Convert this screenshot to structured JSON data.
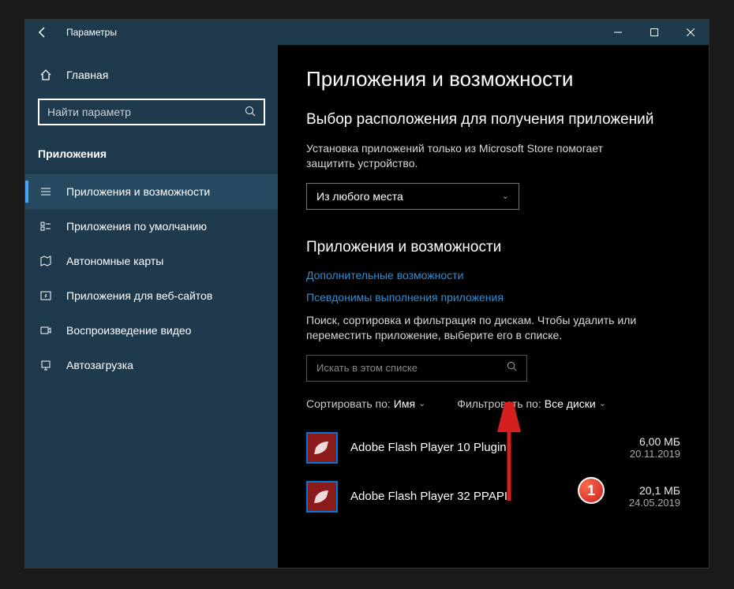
{
  "titlebar": {
    "title": "Параметры"
  },
  "sidebar": {
    "home": "Главная",
    "search_placeholder": "Найти параметр",
    "category": "Приложения",
    "items": [
      {
        "label": "Приложения и возможности"
      },
      {
        "label": "Приложения по умолчанию"
      },
      {
        "label": "Автономные карты"
      },
      {
        "label": "Приложения для веб-сайтов"
      },
      {
        "label": "Воспроизведение видео"
      },
      {
        "label": "Автозагрузка"
      }
    ]
  },
  "main": {
    "page_title": "Приложения и возможности",
    "section1_title": "Выбор расположения для получения приложений",
    "section1_desc": "Установка приложений только из Microsoft Store помогает защитить устройство.",
    "source_dropdown": "Из любого места",
    "section2_title": "Приложения и возможности",
    "link_optional": "Дополнительные возможности",
    "link_aliases": "Псевдонимы выполнения приложения",
    "list_desc": "Поиск, сортировка и фильтрация по дискам. Чтобы удалить или переместить приложение, выберите его в списке.",
    "list_search_placeholder": "Искать в этом списке",
    "sort_label": "Сортировать по:",
    "sort_value": "Имя",
    "filter_label": "Фильтровать по:",
    "filter_value": "Все диски",
    "apps": [
      {
        "name": "Adobe Flash Player 10 Plugin",
        "size": "6,00 МБ",
        "date": "20.11.2019"
      },
      {
        "name": "Adobe Flash Player 32 PPAPI",
        "size": "20,1 МБ",
        "date": "24.05.2019"
      }
    ]
  },
  "annotation": {
    "badge": "1"
  }
}
